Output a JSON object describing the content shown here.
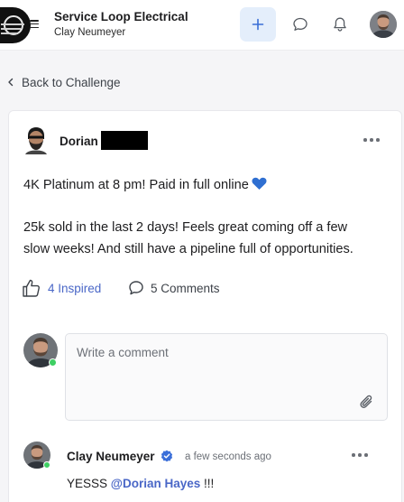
{
  "header": {
    "org_name": "Service Loop Electrical",
    "user_name": "Clay Neumeyer",
    "logo_icon": "company-logo",
    "menu_icon": "hamburger-menu-icon",
    "add_icon": "plus-icon",
    "chat_icon": "chat-bubble-icon",
    "notifications_icon": "bell-icon",
    "avatar_icon": "user-avatar"
  },
  "nav": {
    "back_label": "Back to Challenge",
    "back_icon": "chevron-left-icon"
  },
  "post": {
    "author_first_name": "Dorian",
    "author_last_name_redacted": true,
    "line1": "4K Platinum at 8 pm! Paid in full online",
    "line1_emoji": "blue-heart-icon",
    "line2": "25k sold in the last 2 days! Feels great coming off a few",
    "line3": "slow weeks! And still have a pipeline full of opportunities.",
    "inspired_label": "4 Inspired",
    "comments_label": "5 Comments"
  },
  "comment_input": {
    "placeholder": "Write a comment",
    "attach_icon": "paperclip-icon"
  },
  "comments": [
    {
      "author": "Clay Neumeyer",
      "verified": true,
      "time": "a few seconds ago",
      "text_before": "YESSS ",
      "mention": "@Dorian Hayes",
      "text_after": " !!!"
    }
  ],
  "colors": {
    "accent": "#4a67c7",
    "add_button_bg": "#e4eefb",
    "online": "#3ecf63",
    "verified": "#3b6fd9",
    "heart": "#2f6fd1"
  }
}
